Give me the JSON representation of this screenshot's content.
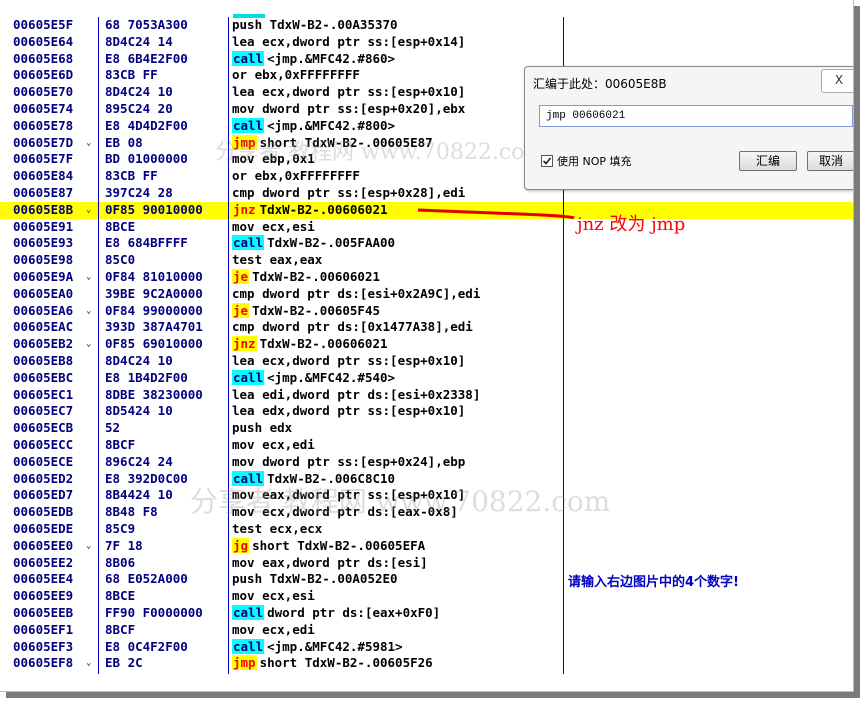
{
  "window": {
    "title_cropped": ""
  },
  "listing": {
    "rows": [
      {
        "addr": "00605E5F",
        "mark": "",
        "hex": "68 7053A300",
        "kw": "",
        "kwtype": "",
        "text": "push TdxW-B2-.00A35370"
      },
      {
        "addr": "00605E64",
        "mark": "",
        "hex": "8D4C24 14",
        "kw": "",
        "kwtype": "",
        "text": "lea ecx,dword ptr ss:[esp+0x14]"
      },
      {
        "addr": "00605E68",
        "mark": "",
        "hex": "E8 6B4E2F00",
        "kw": "call",
        "kwtype": "call",
        "text": "<jmp.&MFC42.#860>"
      },
      {
        "addr": "00605E6D",
        "mark": "",
        "hex": "83CB FF",
        "kw": "",
        "kwtype": "",
        "text": "or ebx,0xFFFFFFFF"
      },
      {
        "addr": "00605E70",
        "mark": "",
        "hex": "8D4C24 10",
        "kw": "",
        "kwtype": "",
        "text": "lea ecx,dword ptr ss:[esp+0x10]"
      },
      {
        "addr": "00605E74",
        "mark": "",
        "hex": "895C24 20",
        "kw": "",
        "kwtype": "",
        "text": "mov dword ptr ss:[esp+0x20],ebx"
      },
      {
        "addr": "00605E78",
        "mark": "",
        "hex": "E8 4D4D2F00",
        "kw": "call",
        "kwtype": "call",
        "text": "<jmp.&MFC42.#800>"
      },
      {
        "addr": "00605E7D",
        "mark": "⌄",
        "hex": "EB 08",
        "kw": "jmp",
        "kwtype": "jump",
        "text": "short TdxW-B2-.00605E87"
      },
      {
        "addr": "00605E7F",
        "mark": "",
        "hex": "BD 01000000",
        "kw": "",
        "kwtype": "",
        "text": "mov ebp,0x1"
      },
      {
        "addr": "00605E84",
        "mark": "",
        "hex": "83CB FF",
        "kw": "",
        "kwtype": "",
        "text": "or ebx,0xFFFFFFFF"
      },
      {
        "addr": "00605E87",
        "mark": "",
        "hex": "397C24 28",
        "kw": "",
        "kwtype": "",
        "text": "cmp dword ptr ss:[esp+0x28],edi"
      },
      {
        "addr": "00605E8B",
        "mark": "⌄",
        "hex": "0F85 90010000",
        "kw": "jnz",
        "kwtype": "jump",
        "text": "TdxW-B2-.00606021",
        "highlight": true
      },
      {
        "addr": "00605E91",
        "mark": "",
        "hex": "8BCE",
        "kw": "",
        "kwtype": "",
        "text": "mov ecx,esi"
      },
      {
        "addr": "00605E93",
        "mark": "",
        "hex": "E8 684BFFFF",
        "kw": "call",
        "kwtype": "call",
        "text": "TdxW-B2-.005FAA00"
      },
      {
        "addr": "00605E98",
        "mark": "",
        "hex": "85C0",
        "kw": "",
        "kwtype": "",
        "text": "test eax,eax"
      },
      {
        "addr": "00605E9A",
        "mark": "⌄",
        "hex": "0F84 81010000",
        "kw": "je",
        "kwtype": "jump",
        "text": "TdxW-B2-.00606021"
      },
      {
        "addr": "00605EA0",
        "mark": "",
        "hex": "39BE 9C2A0000",
        "kw": "",
        "kwtype": "",
        "text": "cmp dword ptr ds:[esi+0x2A9C],edi"
      },
      {
        "addr": "00605EA6",
        "mark": "⌄",
        "hex": "0F84 99000000",
        "kw": "je",
        "kwtype": "jump",
        "text": "TdxW-B2-.00605F45"
      },
      {
        "addr": "00605EAC",
        "mark": "",
        "hex": "393D 387A4701",
        "kw": "",
        "kwtype": "",
        "text": "cmp dword ptr ds:[0x1477A38],edi"
      },
      {
        "addr": "00605EB2",
        "mark": "⌄",
        "hex": "0F85 69010000",
        "kw": "jnz",
        "kwtype": "jump",
        "text": "TdxW-B2-.00606021"
      },
      {
        "addr": "00605EB8",
        "mark": "",
        "hex": "8D4C24 10",
        "kw": "",
        "kwtype": "",
        "text": "lea ecx,dword ptr ss:[esp+0x10]"
      },
      {
        "addr": "00605EBC",
        "mark": "",
        "hex": "E8 1B4D2F00",
        "kw": "call",
        "kwtype": "call",
        "text": "<jmp.&MFC42.#540>"
      },
      {
        "addr": "00605EC1",
        "mark": "",
        "hex": "8DBE 38230000",
        "kw": "",
        "kwtype": "",
        "text": "lea edi,dword ptr ds:[esi+0x2338]"
      },
      {
        "addr": "00605EC7",
        "mark": "",
        "hex": "8D5424 10",
        "kw": "",
        "kwtype": "",
        "text": "lea edx,dword ptr ss:[esp+0x10]"
      },
      {
        "addr": "00605ECB",
        "mark": "",
        "hex": "52",
        "kw": "",
        "kwtype": "",
        "text": "push edx"
      },
      {
        "addr": "00605ECC",
        "mark": "",
        "hex": "8BCF",
        "kw": "",
        "kwtype": "",
        "text": "mov ecx,edi"
      },
      {
        "addr": "00605ECE",
        "mark": "",
        "hex": "896C24 24",
        "kw": "",
        "kwtype": "",
        "text": "mov dword ptr ss:[esp+0x24],ebp"
      },
      {
        "addr": "00605ED2",
        "mark": "",
        "hex": "E8 392D0C00",
        "kw": "call",
        "kwtype": "call",
        "text": "TdxW-B2-.006C8C10"
      },
      {
        "addr": "00605ED7",
        "mark": "",
        "hex": "8B4424 10",
        "kw": "",
        "kwtype": "",
        "text": "mov eax,dword ptr ss:[esp+0x10]"
      },
      {
        "addr": "00605EDB",
        "mark": "",
        "hex": "8B48 F8",
        "kw": "",
        "kwtype": "",
        "text": "mov ecx,dword ptr ds:[eax-0x8]"
      },
      {
        "addr": "00605EDE",
        "mark": "",
        "hex": "85C9",
        "kw": "",
        "kwtype": "",
        "text": "test ecx,ecx"
      },
      {
        "addr": "00605EE0",
        "mark": "⌄",
        "hex": "7F 18",
        "kw": "jg",
        "kwtype": "jump",
        "text": "short TdxW-B2-.00605EFA"
      },
      {
        "addr": "00605EE2",
        "mark": "",
        "hex": "8B06",
        "kw": "",
        "kwtype": "",
        "text": "mov eax,dword ptr ds:[esi]"
      },
      {
        "addr": "00605EE4",
        "mark": "",
        "hex": "68 E052A000",
        "kw": "",
        "kwtype": "",
        "text": "push TdxW-B2-.00A052E0"
      },
      {
        "addr": "00605EE9",
        "mark": "",
        "hex": "8BCE",
        "kw": "",
        "kwtype": "",
        "text": "mov ecx,esi"
      },
      {
        "addr": "00605EEB",
        "mark": "",
        "hex": "FF90 F0000000",
        "kw": "call",
        "kwtype": "call",
        "text": "dword ptr ds:[eax+0xF0]"
      },
      {
        "addr": "00605EF1",
        "mark": "",
        "hex": "8BCF",
        "kw": "",
        "kwtype": "",
        "text": "mov ecx,edi"
      },
      {
        "addr": "00605EF3",
        "mark": "",
        "hex": "E8 0C4F2F00",
        "kw": "call",
        "kwtype": "call",
        "text": "<jmp.&MFC42.#5981>"
      },
      {
        "addr": "00605EF8",
        "mark": "⌄",
        "hex": "EB 2C",
        "kw": "jmp",
        "kwtype": "jump",
        "text": "short TdxW-B2-.00605F26"
      }
    ]
  },
  "dialog": {
    "title": "汇编于此处：00605E8B",
    "close_label": "X",
    "input_value": "jmp 00606021",
    "checkbox_label": "使用 NOP 填充",
    "checkbox_checked": true,
    "assemble_label": "汇编",
    "cancel_label": "取消"
  },
  "annotations": {
    "change_note": "jnz 改为 jmp",
    "captcha_note": "请输入右边图片中的4个数字!"
  },
  "watermarks": {
    "wm1": "分享者 教程网 www.70822.com",
    "wm2": "分享者 教程网 www.70822.com"
  },
  "colors": {
    "address": "#000080",
    "highlight": "#ffff00",
    "call_bg": "#00ffff",
    "jump_fg": "#ff0000",
    "annotation_red": "#ff0000",
    "annotation_blue": "#0000c0"
  }
}
